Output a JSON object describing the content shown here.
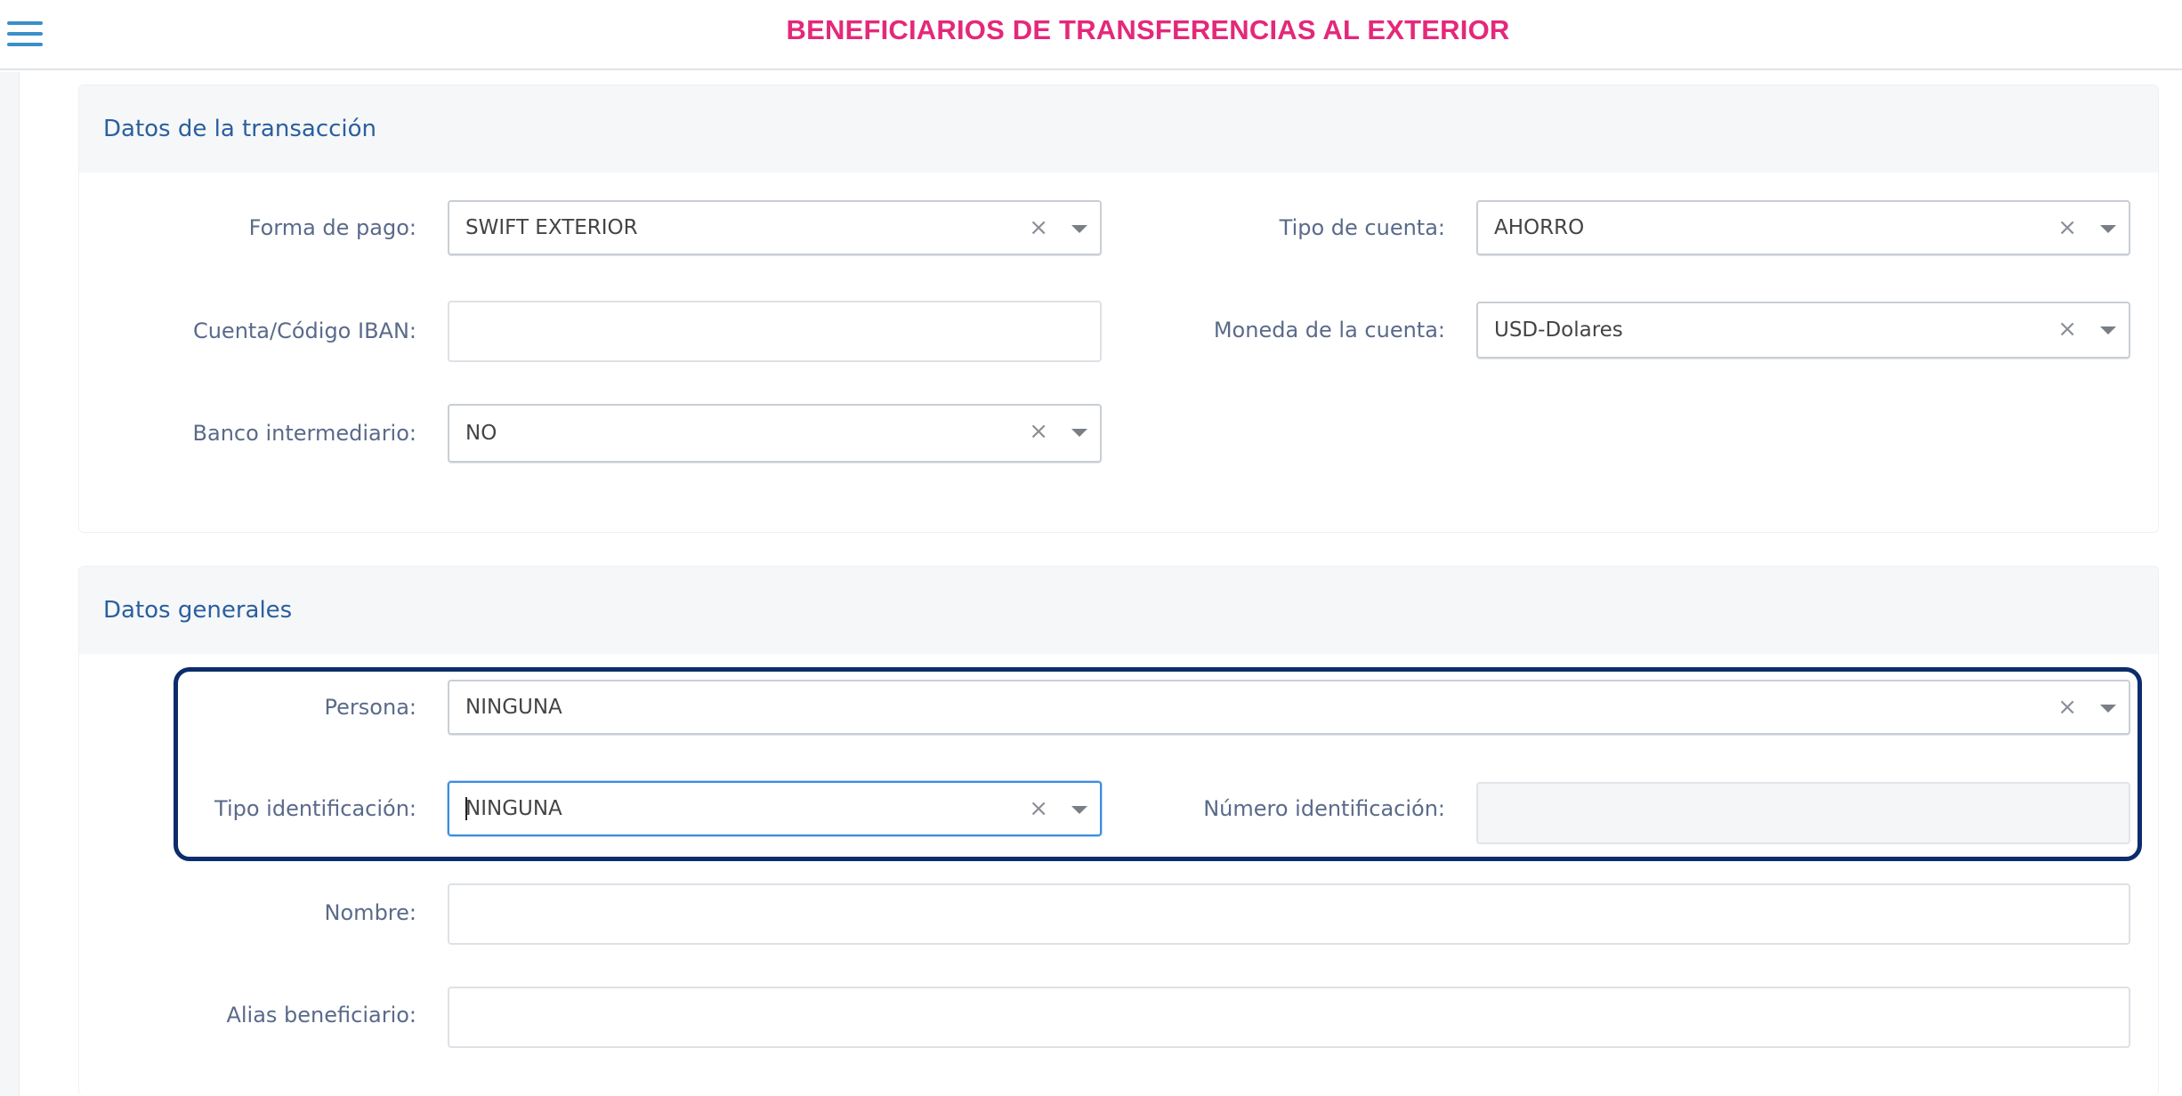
{
  "header": {
    "title": "BENEFICIARIOS DE TRANSFERENCIAS AL EXTERIOR",
    "menu_icon": "hamburger-menu-icon"
  },
  "transaccion": {
    "title": "Datos de la transacción",
    "forma_pago": {
      "label": "Forma de pago:",
      "value": "SWIFT EXTERIOR"
    },
    "tipo_cuenta": {
      "label": "Tipo de cuenta:",
      "value": "AHORRO"
    },
    "cuenta_iban": {
      "label": "Cuenta/Código IBAN:",
      "value": ""
    },
    "moneda": {
      "label": "Moneda de la cuenta:",
      "value": "USD-Dolares"
    },
    "banco_intermediario": {
      "label": "Banco intermediario:",
      "value": "NO"
    }
  },
  "generales": {
    "title": "Datos generales",
    "persona": {
      "label": "Persona:",
      "value": "NINGUNA"
    },
    "tipo_identificacion": {
      "label": "Tipo identificación:",
      "value": "NINGUNA"
    },
    "numero_identificacion": {
      "label": "Número identificación:",
      "value": ""
    },
    "nombre": {
      "label": "Nombre:",
      "value": ""
    },
    "alias": {
      "label": "Alias beneficiario:",
      "value": ""
    }
  },
  "icons": {
    "clear": "×",
    "dropdown": "chevron-down-icon"
  },
  "colors": {
    "title": "#e4287a",
    "section_title": "#2a5f9e",
    "highlight": "#0b2d6b",
    "focus": "#3b8de0"
  }
}
